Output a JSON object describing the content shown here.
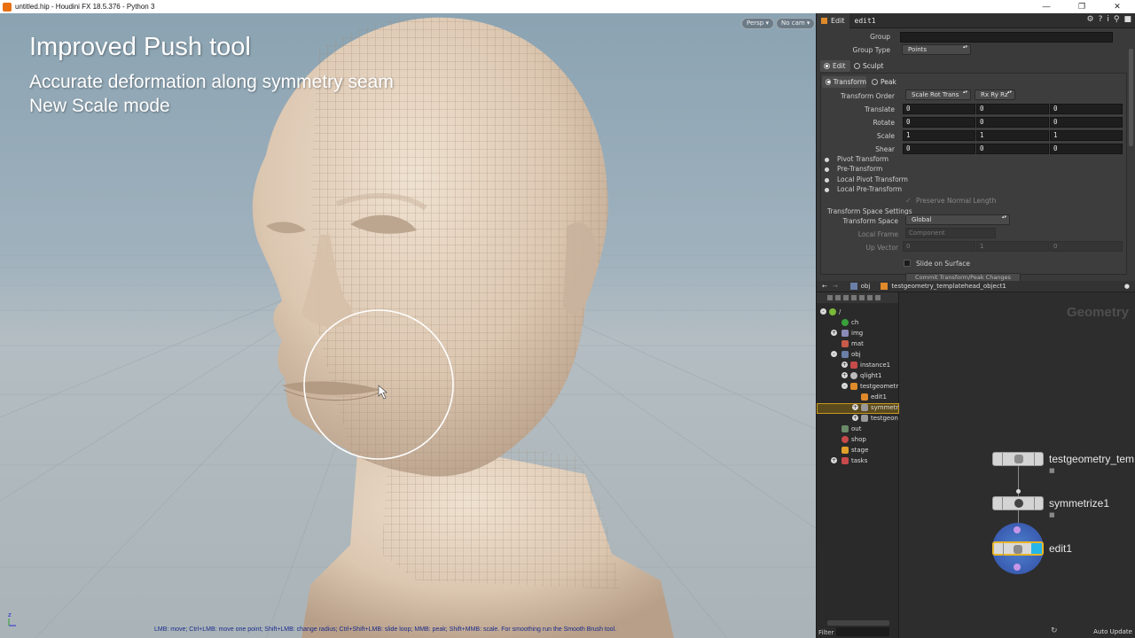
{
  "window": {
    "title": "untitled.hip - Houdini FX 18.5.376 - Python 3",
    "controls": [
      "—",
      "❐",
      "✕"
    ]
  },
  "viewport": {
    "overlay": {
      "title": "Improved Push tool",
      "lines": [
        "Accurate deformation along symmetry seam",
        "New Scale mode"
      ]
    },
    "camera_buttons": [
      "Persp ▾",
      "No cam ▾"
    ],
    "status_hint": "LMB: move; Ctrl+LMB: move one point; Shift+LMB: change radius; Ctrl+Shift+LMB: slide loop; MMB: peak; Shift+MMB: scale. For smoothing run the Smooth Brush tool.",
    "axis_label": "z"
  },
  "params": {
    "tab_label": "Edit",
    "node_name": "edit1",
    "group_label": "Group",
    "group_value": "",
    "group_type_label": "Group Type",
    "group_type_value": "Points",
    "mode_tabs": [
      "Edit",
      "Sculpt"
    ],
    "sub_tabs": [
      "Transform",
      "Peak"
    ],
    "transform_order_label": "Transform Order",
    "transform_order_value": "Scale Rot Trans",
    "rotate_order_value": "Rx Ry Rz",
    "vectors": [
      {
        "label": "Translate",
        "values": [
          "0",
          "0",
          "0"
        ]
      },
      {
        "label": "Rotate",
        "values": [
          "0",
          "0",
          "0"
        ]
      },
      {
        "label": "Scale",
        "values": [
          "1",
          "1",
          "1"
        ]
      },
      {
        "label": "Shear",
        "values": [
          "0",
          "0",
          "0"
        ]
      }
    ],
    "folders": [
      "Pivot Transform",
      "Pre-Transform",
      "Local Pivot Transform",
      "Local Pre-Transform"
    ],
    "preserve_normal_length": "Preserve Normal Length",
    "space_settings_label": "Transform Space Settings",
    "transform_space_label": "Transform Space",
    "transform_space_value": "Global",
    "local_frame_label": "Local Frame",
    "local_frame_value": "Component",
    "up_vector_label": "Up Vector",
    "up_vector_values": [
      "0",
      "1",
      "0"
    ],
    "slide_on_surface": "Slide on Surface",
    "commit_button": "Commit Transform/Peak Changes"
  },
  "network": {
    "path_root": "obj",
    "path_node": "testgeometry_templatehead_object1",
    "context_label": "Geometry",
    "tree": [
      {
        "label": "/",
        "indent": 0
      },
      {
        "label": "ch",
        "indent": 1
      },
      {
        "label": "img",
        "indent": 1
      },
      {
        "label": "mat",
        "indent": 1
      },
      {
        "label": "obj",
        "indent": 1
      },
      {
        "label": "instance1",
        "indent": 2
      },
      {
        "label": "qlight1",
        "indent": 2
      },
      {
        "label": "testgeometr",
        "indent": 2
      },
      {
        "label": "edit1",
        "indent": 3
      },
      {
        "label": "symmetr",
        "indent": 3
      },
      {
        "label": "testgeon",
        "indent": 3
      },
      {
        "label": "out",
        "indent": 1
      },
      {
        "label": "shop",
        "indent": 1
      },
      {
        "label": "stage",
        "indent": 1
      },
      {
        "label": "tasks",
        "indent": 1
      }
    ],
    "filter_label": "Filter",
    "nodes": [
      "testgeometry_tem",
      "symmetrize1",
      "edit1"
    ],
    "auto_update": "Auto Update"
  },
  "colors": {
    "accent": "#e8b52a",
    "display_flag": "#26b6e8",
    "selected_ring": "#8a6fd6"
  }
}
